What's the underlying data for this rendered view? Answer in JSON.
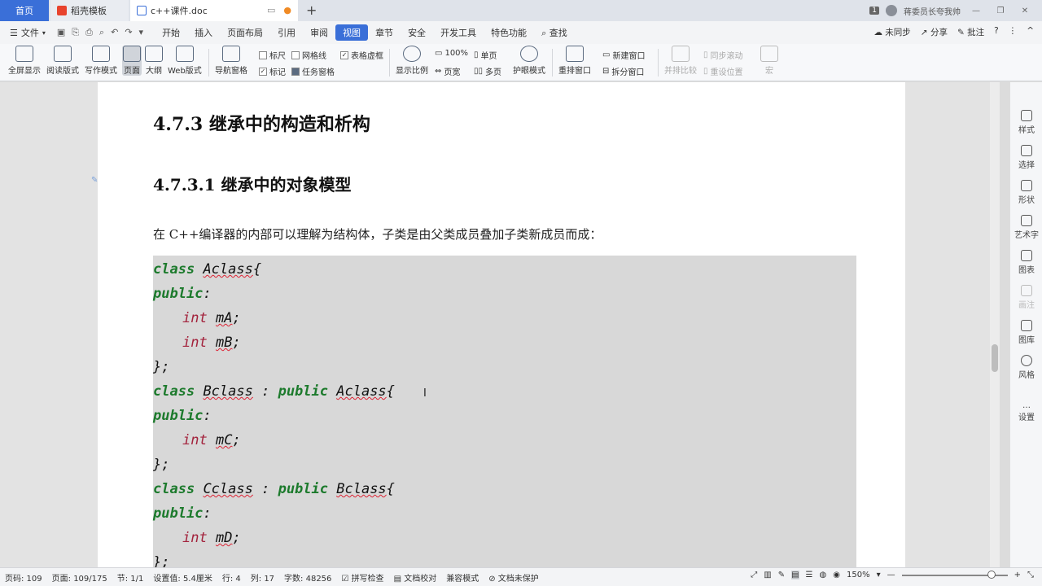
{
  "tabs": {
    "home": "首页",
    "templates": "稻壳模板",
    "document": "c++课件.doc",
    "new_tab": "+"
  },
  "titlebar": {
    "window_count": "1",
    "user": "蒋委员长夸我帅"
  },
  "menu": {
    "file": "文件",
    "tabs": [
      "开始",
      "插入",
      "页面布局",
      "引用",
      "审阅",
      "视图",
      "章节",
      "安全",
      "开发工具",
      "特色功能",
      "查找"
    ],
    "active_tab": "视图",
    "sync": "未同步",
    "share": "分享",
    "comment": "批注"
  },
  "ribbon": {
    "fullscreen": "全屏显示",
    "reading": "阅读版式",
    "writing": "写作模式",
    "page": "页面",
    "outline": "大纲",
    "web": "Web版式",
    "nav_pane": "导航窗格",
    "ruler": "标尺",
    "gridlines": "网格线",
    "table_gridlines": "表格虚框",
    "marks": "标记",
    "task_pane": "任务窗格",
    "zoom_ratio": "显示比例",
    "zoom_100": "100%",
    "page_width": "页宽",
    "single_page": "单页",
    "multi_page": "多页",
    "eye_mode": "护眼模式",
    "rearrange": "重排窗口",
    "new_window": "新建窗口",
    "split_window": "拆分窗口",
    "side_by_side": "并排比较",
    "sync_scroll": "同步滚动",
    "reset_position": "重设位置",
    "macro": "宏"
  },
  "document": {
    "heading3": "4.7.3  继承中的构造和析构",
    "heading4": "4.7.3.1  继承中的对象模型",
    "paragraph": "在 C++编译器的内部可以理解为结构体，子类是由父类成员叠加子类新成员而成：",
    "code": {
      "l1_kw": "class",
      "l1_name": "Aclass",
      "l1_end": "{",
      "l2_kw": "public",
      "l2_end": ":",
      "l3_type": "int",
      "l3_var": "mA",
      "l3_end": ";",
      "l4_type": "int",
      "l4_var": "mB",
      "l4_end": ";",
      "l5": "};",
      "l6_kw": "class",
      "l6_name": "Bclass",
      "l6_sep": " : ",
      "l6_kw2": "public",
      "l6_base": "Aclass",
      "l6_end": "{",
      "l7_kw": "public",
      "l7_end": ":",
      "l8_type": "int",
      "l8_var": "mC",
      "l8_end": ";",
      "l9": "};",
      "l10_kw": "class",
      "l10_name": "Cclass",
      "l10_sep": " : ",
      "l10_kw2": "public",
      "l10_base": "Bclass",
      "l10_end": "{",
      "l11_kw": "public",
      "l11_end": ":",
      "l12_type": "int",
      "l12_var": "mD",
      "l12_end": ";",
      "l13": "};"
    }
  },
  "sidepanel": {
    "style": "样式",
    "select": "选择",
    "shape": "形状",
    "wordart": "艺术字",
    "chart": "图表",
    "comment": "画注",
    "gallery": "图库",
    "theme": "风格",
    "settings": "设置"
  },
  "status": {
    "page_code": "页码: 109",
    "pages": "页面: 109/175",
    "section": "节: 1/1",
    "position": "设置值: 5.4厘米",
    "row": "行: 4",
    "col": "列: 17",
    "word_count": "字数: 48256",
    "spell_check": "拼写检查",
    "proofread": "文档校对",
    "compat_mode": "兼容模式",
    "protection": "文档未保护",
    "zoom": "150%"
  }
}
